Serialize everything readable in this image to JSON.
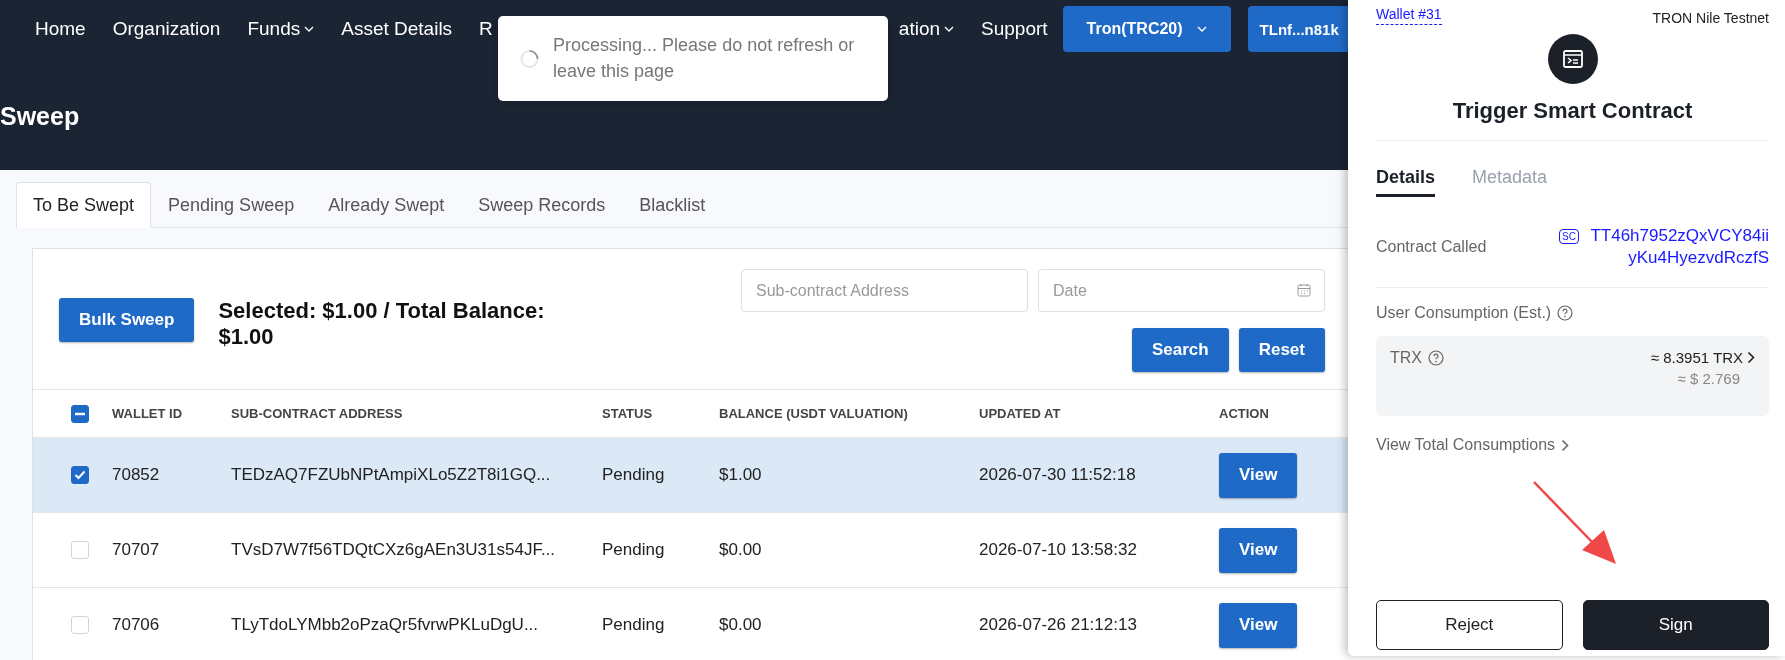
{
  "nav": {
    "items": [
      {
        "label": "Home",
        "dropdown": false
      },
      {
        "label": "Organization",
        "dropdown": false
      },
      {
        "label": "Funds",
        "dropdown": true
      },
      {
        "label": "Asset Details",
        "dropdown": false
      },
      {
        "label": "R",
        "dropdown": false
      },
      {
        "label": "ation",
        "dropdown": true
      },
      {
        "label": "Support",
        "dropdown": false
      }
    ],
    "network_button": "Tron(TRC20)",
    "account_button": "TLnf...n81k"
  },
  "toast": {
    "message": "Processing... Please do not refresh or leave this page"
  },
  "page_title": "Sweep",
  "tabs": [
    {
      "label": "To Be Swept",
      "selected": true
    },
    {
      "label": "Pending Sweep",
      "selected": false
    },
    {
      "label": "Already Swept",
      "selected": false
    },
    {
      "label": "Sweep Records",
      "selected": false
    },
    {
      "label": "Blacklist",
      "selected": false
    }
  ],
  "toolbar": {
    "bulk_button": "Bulk Sweep",
    "summary": "Selected: $1.00 / Total Balance: $1.00",
    "address_field": {
      "placeholder": "Sub-contract Address"
    },
    "date_field": {
      "placeholder": "Date"
    },
    "search_button": "Search",
    "reset_button": "Reset"
  },
  "table": {
    "select_all_indeterminate": true,
    "columns": [
      "WALLET ID",
      "SUB-CONTRACT ADDRESS",
      "STATUS",
      "BALANCE (USDT VALUATION)",
      "UPDATED AT",
      "ACTION"
    ],
    "rows": [
      {
        "selected": true,
        "wallet_id": "70852",
        "address": "TEDzAQ7FZUbNPtAmpiXLo5Z2T8i1GQ...",
        "status": "Pending",
        "balance": "$1.00",
        "updated_at": "2026-07-30 11:52:18",
        "action": "View"
      },
      {
        "selected": false,
        "wallet_id": "70707",
        "address": "TVsD7W7f56TDQtCXz6gAEn3U31s54JF...",
        "status": "Pending",
        "balance": "$0.00",
        "updated_at": "2026-07-10 13:58:32",
        "action": "View"
      },
      {
        "selected": false,
        "wallet_id": "70706",
        "address": "TLyTdoLYMbb2oPzaQr5fvrwPKLuDgU...",
        "status": "Pending",
        "balance": "$0.00",
        "updated_at": "2026-07-26 21:12:13",
        "action": "View"
      }
    ]
  },
  "wallet_popup": {
    "wallet": "Wallet #31",
    "network": "TRON Nile Testnet",
    "title": "Trigger Smart Contract",
    "tabs": [
      {
        "label": "Details",
        "selected": true
      },
      {
        "label": "Metadata",
        "selected": false
      }
    ],
    "contract_label": "Contract Called",
    "contract_badge": "SC",
    "contract_address": "TT46h7952zQxVCY84iiyKu4HyezvdRczfS",
    "consumption_label": "User Consumption (Est.)",
    "token": "TRX",
    "amount": "≈ 8.3951 TRX",
    "usd": "≈ $ 2.769",
    "view_total": "View Total Consumptions",
    "reject_button": "Reject",
    "sign_button": "Sign"
  }
}
